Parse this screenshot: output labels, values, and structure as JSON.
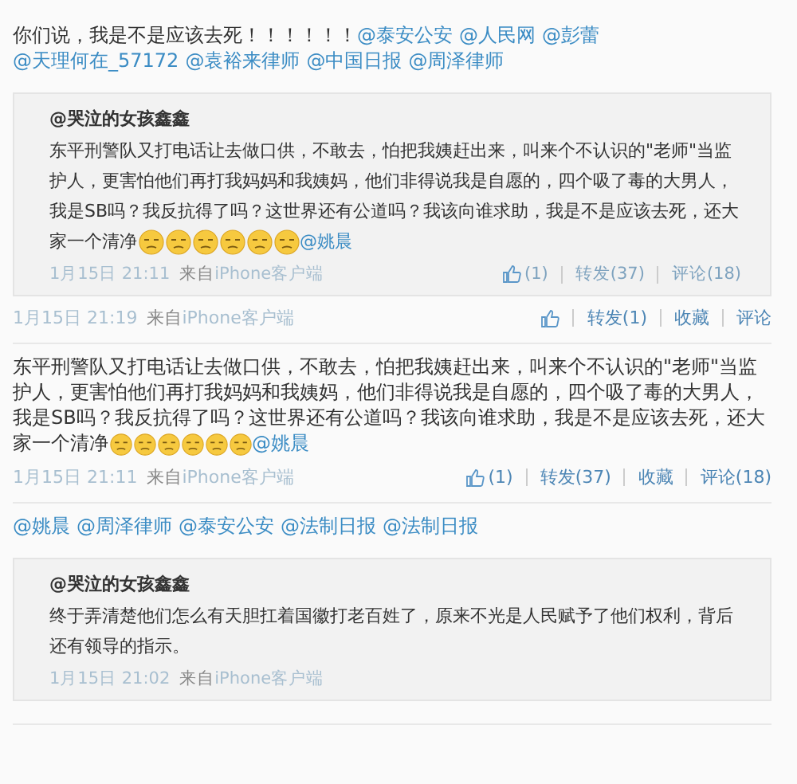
{
  "posts": [
    {
      "content": [
        {
          "kind": "text",
          "text": "你们说，我是不是应该去死！！！！！！"
        },
        {
          "kind": "mention",
          "text": "@泰安公安"
        },
        {
          "kind": "mention",
          "text": "@人民网"
        },
        {
          "kind": "mention",
          "text": "@彭蕾"
        },
        {
          "kind": "mention",
          "text": "@天理何在_57172"
        },
        {
          "kind": "mention",
          "text": "@袁裕来律师"
        },
        {
          "kind": "mention",
          "text": "@中国日报"
        },
        {
          "kind": "mention",
          "text": "@周泽律师"
        }
      ],
      "quote": {
        "author": "@哭泣的女孩鑫鑫",
        "content": [
          {
            "kind": "text",
            "text": "东平刑警队又打电话让去做口供，不敢去，怕把我姨赶出来，叫来个不认识的\"老师\"当监护人，更害怕他们再打我妈妈和我姨妈，他们非得说我是自愿的，四个吸了毒的大男人，我是SB吗？我反抗得了吗？这世界还有公道吗？我该向谁求助，我是不是应该去死，还大家一个清净"
          },
          {
            "kind": "emoji"
          },
          {
            "kind": "emoji"
          },
          {
            "kind": "emoji"
          },
          {
            "kind": "emoji"
          },
          {
            "kind": "emoji"
          },
          {
            "kind": "emoji"
          },
          {
            "kind": "mention",
            "text": "@姚晨"
          }
        ],
        "time": "1月15日 21:11",
        "from": "来自",
        "source": "iPhone客户端",
        "actions": [
          {
            "kind": "like",
            "text": "(1)"
          },
          {
            "kind": "link",
            "text": "转发(37)"
          },
          {
            "kind": "link",
            "text": "评论(18)"
          }
        ]
      },
      "time": "1月15日 21:19",
      "from": "来自",
      "source": "iPhone客户端",
      "actions": [
        {
          "kind": "like"
        },
        {
          "kind": "link",
          "text": "转发(1)"
        },
        {
          "kind": "link",
          "text": "收藏"
        },
        {
          "kind": "link",
          "text": "评论"
        }
      ]
    },
    {
      "content": [
        {
          "kind": "text",
          "text": "东平刑警队又打电话让去做口供，不敢去，怕把我姨赶出来，叫来个不认识的\"老师\"当监护人，更害怕他们再打我妈妈和我姨妈，他们非得说我是自愿的，四个吸了毒的大男人，我是SB吗？我反抗得了吗？这世界还有公道吗？我该向谁求助，我是不是应该去死，还大家一个清净"
        },
        {
          "kind": "emoji"
        },
        {
          "kind": "emoji"
        },
        {
          "kind": "emoji"
        },
        {
          "kind": "emoji"
        },
        {
          "kind": "emoji"
        },
        {
          "kind": "emoji"
        },
        {
          "kind": "mention",
          "text": "@姚晨"
        }
      ],
      "time": "1月15日 21:11",
      "from": "来自",
      "source": "iPhone客户端",
      "actions": [
        {
          "kind": "like",
          "text": "(1)"
        },
        {
          "kind": "link",
          "text": "转发(37)"
        },
        {
          "kind": "link",
          "text": "收藏"
        },
        {
          "kind": "link",
          "text": "评论(18)"
        }
      ]
    },
    {
      "content": [
        {
          "kind": "mention",
          "text": "@姚晨"
        },
        {
          "kind": "mention",
          "text": "@周泽律师"
        },
        {
          "kind": "mention",
          "text": "@泰安公安"
        },
        {
          "kind": "mention",
          "text": "@法制日报"
        },
        {
          "kind": "mention",
          "text": "@法制日报"
        }
      ],
      "quote": {
        "author": "@哭泣的女孩鑫鑫",
        "content": [
          {
            "kind": "text",
            "text": "终于弄清楚他们怎么有天胆扛着国徽打老百姓了，原来不光是人民赋予了他们权利，背后还有领导的指示。"
          }
        ],
        "time": "1月15日 21:02",
        "from": "来自",
        "source": "iPhone客户端"
      }
    }
  ]
}
